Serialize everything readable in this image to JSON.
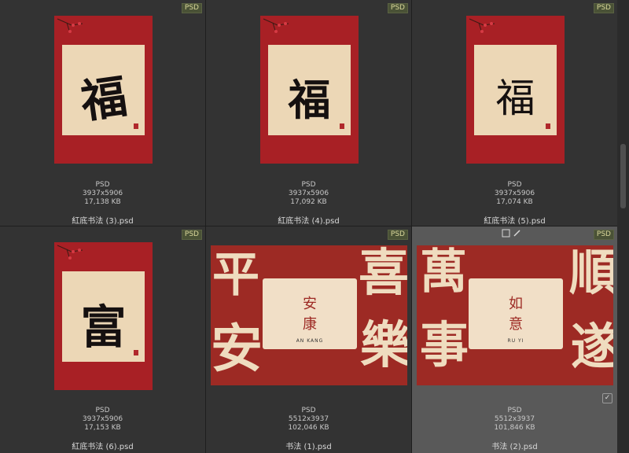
{
  "badge": "PSD",
  "files": [
    {
      "type": "PSD",
      "dims": "3937x5906",
      "size": "17,138 KB",
      "name": "紅底书法 (3).psd",
      "glyph": "福"
    },
    {
      "type": "PSD",
      "dims": "3937x5906",
      "size": "17,092 KB",
      "name": "紅底书法 (4).psd",
      "glyph": "福"
    },
    {
      "type": "PSD",
      "dims": "3937x5906",
      "size": "17,074 KB",
      "name": "紅底书法 (5).psd",
      "glyph": "福"
    },
    {
      "type": "PSD",
      "dims": "3937x5906",
      "size": "17,153 KB",
      "name": "紅底书法 (6).psd",
      "glyph": "富"
    },
    {
      "type": "PSD",
      "dims": "5512x3937",
      "size": "102,046 KB",
      "name": "书法 (1).psd",
      "left_chars": [
        "平",
        "安"
      ],
      "right_chars": [
        "喜",
        "樂"
      ],
      "card_chars": [
        "安",
        "康"
      ],
      "card_pinyin": [
        "AN",
        "KANG"
      ]
    },
    {
      "type": "PSD",
      "dims": "5512x3937",
      "size": "101,846 KB",
      "name": "书法 (2).psd",
      "left_chars": [
        "萬",
        "事"
      ],
      "right_chars": [
        "順",
        "遂"
      ],
      "card_chars": [
        "如",
        "意"
      ],
      "card_pinyin": [
        "RU",
        "YI"
      ]
    }
  ],
  "colors": {
    "poster_red": "#a82025",
    "paper": "#ecd7b6",
    "banner_red": "#9d2a24",
    "selected_bg": "#595959"
  },
  "icons": {
    "select-frame": "square-icon",
    "edit": "pencil-icon",
    "checkbox": "checkmark-icon"
  }
}
